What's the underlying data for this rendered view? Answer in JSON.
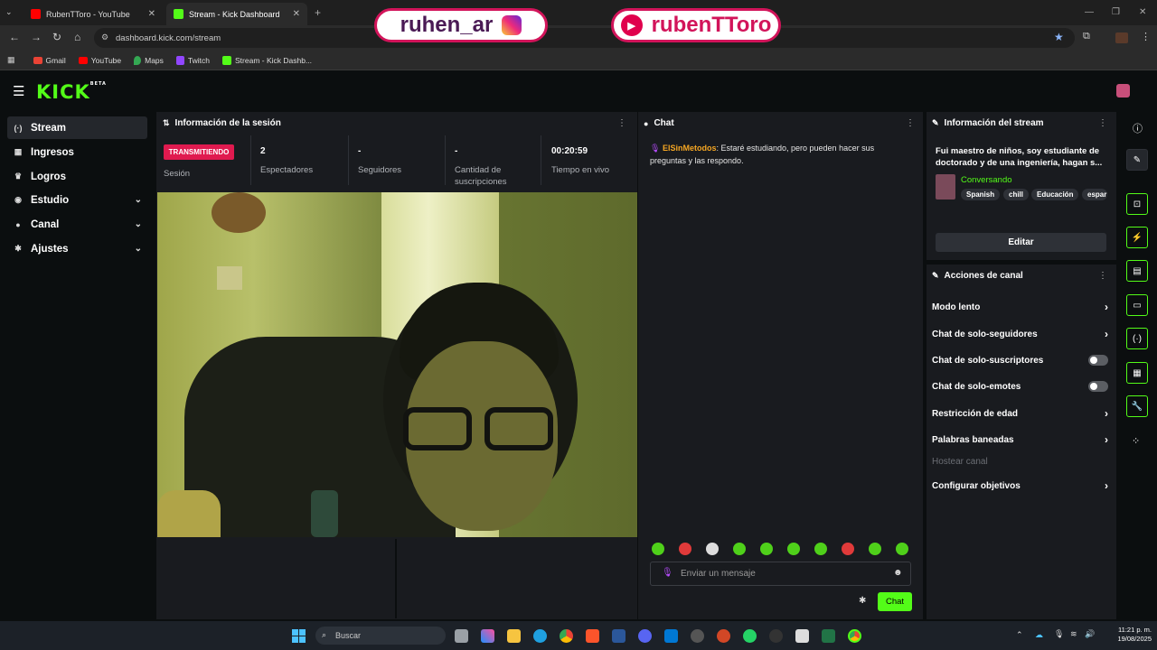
{
  "browser": {
    "tabs": [
      {
        "title": "RubenTToro - YouTube",
        "close": "✕"
      },
      {
        "title": "Stream - Kick Dashboard",
        "close": "✕"
      }
    ],
    "new_tab": "+",
    "address": "dashboard.kick.com/stream",
    "bookmarks": [
      "Gmail",
      "YouTube",
      "Maps",
      "Twitch",
      "Stream - Kick Dashb..."
    ]
  },
  "overlays": {
    "instagram": "ruhen_ar",
    "youtube": "rubenTToro"
  },
  "kick": {
    "logo": "KICK",
    "logo_badge": "BETA",
    "sidebar": [
      {
        "label": "Stream",
        "icon": "broadcast-icon",
        "active": true,
        "glyph": "(·)"
      },
      {
        "label": "Ingresos",
        "icon": "money-icon",
        "glyph": "▦"
      },
      {
        "label": "Logros",
        "icon": "trophy-icon",
        "glyph": "♛"
      },
      {
        "label": "Estudio",
        "icon": "studio-icon",
        "glyph": "◉",
        "expand": "⌄"
      },
      {
        "label": "Canal",
        "icon": "channel-icon",
        "glyph": "●",
        "expand": "⌄"
      },
      {
        "label": "Ajustes",
        "icon": "gear-icon",
        "glyph": "✱",
        "expand": "⌄"
      }
    ],
    "session": {
      "title": "Información de la sesión",
      "badge": "TRANSMITIENDO",
      "badge_label": "Sesión",
      "stats": [
        {
          "value": "2",
          "label": "Espectadores"
        },
        {
          "value": "-",
          "label": "Seguidores"
        },
        {
          "value": "-",
          "label": "Cantidad de suscripciones"
        },
        {
          "value": "00:20:59",
          "label": "Tiempo en vivo"
        }
      ]
    },
    "chat": {
      "title": "Chat",
      "messages": [
        {
          "user": "ElSinMetodos",
          "text": ": Estaré estudiando, pero pueden hacer sus preguntas y las respondo."
        }
      ],
      "input_placeholder": "Enviar un mensaje",
      "send_label": "Chat"
    },
    "stream_info": {
      "title": "Información del stream",
      "description": "Fui maestro de niños, soy estudiante de doctorado y de una ingeniería, hagan s...",
      "category": "Conversando",
      "tags": [
        "Spanish",
        "chill",
        "Educación",
        "espar"
      ],
      "edit_label": "Editar"
    },
    "actions": {
      "title": "Acciones de canal",
      "items": [
        {
          "label": "Modo lento",
          "kind": "arrow"
        },
        {
          "label": "Chat de solo-seguidores",
          "kind": "arrow"
        },
        {
          "label": "Chat de solo-suscriptores",
          "kind": "toggle",
          "on": false
        },
        {
          "label": "Chat de solo-emotes",
          "kind": "toggle",
          "on": false
        },
        {
          "label": "Restricción de edad",
          "kind": "arrow"
        },
        {
          "label": "Palabras baneadas",
          "kind": "arrow"
        },
        {
          "label": "Hostear canal",
          "kind": "disabled"
        },
        {
          "label": "Configurar objetivos",
          "kind": "arrow"
        }
      ]
    }
  },
  "taskbar": {
    "search_placeholder": "Buscar",
    "time": "11:21 p. m.",
    "date": "19/08/2025"
  },
  "colors": {
    "kick_green": "#53fc18",
    "live_red": "#e01a4f",
    "panel": "#191b1f",
    "background": "#0b0e0f",
    "username": "#f5a623"
  }
}
